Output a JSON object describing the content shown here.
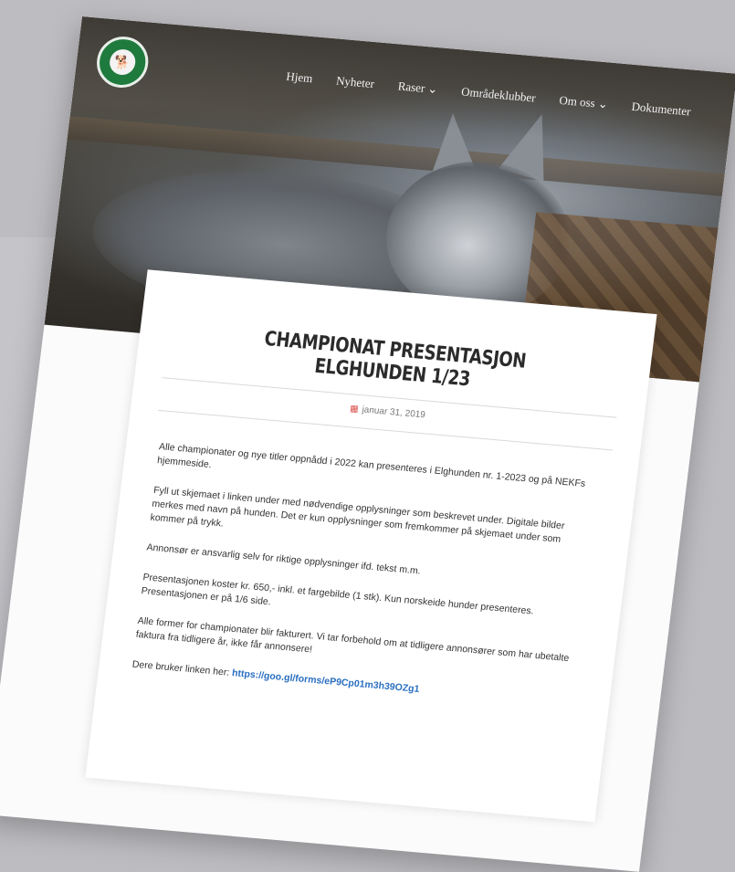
{
  "nav": {
    "items": [
      {
        "label": "Hjem"
      },
      {
        "label": "Nyheter"
      },
      {
        "label": "Raser ⌄"
      },
      {
        "label": "Områdeklubber"
      },
      {
        "label": "Om oss ⌄"
      },
      {
        "label": "Dokumenter"
      }
    ]
  },
  "article": {
    "title": "CHAMPIONAT PRESENTASJON ELGHUNDEN 1/23",
    "date": "januar 31, 2019",
    "paragraphs": [
      "Alle championater og nye titler oppnådd i 2022 kan presenteres i Elghunden nr. 1-2023 og på NEKFs hjemmeside.",
      "Fyll ut skjemaet i linken under med nødvendige opplysninger som beskrevet under. Digitale bilder merkes med navn på hunden. Det er kun opplysninger som fremkommer på skjemaet under som kommer på trykk.",
      "Annonsør er ansvarlig selv for riktige opplysninger ifd. tekst m.m.",
      "Presentasjonen koster kr. 650,- inkl. et fargebilde (1 stk). Kun norskeide hunder presenteres. Presentasjonen er på 1/6 side.",
      "Alle former for championater blir fakturert. Vi tar forbehold om at tidligere annonsører som har ubetalte faktura fra tidligere år, ikke får annonsere!"
    ],
    "link_prefix": "Dere bruker linken her: ",
    "link_text": "https://goo.gl/forms/eP9Cp01m3h39OZg1"
  },
  "colors": {
    "accent": "#1f7a3e",
    "link": "#2a6fc0",
    "date_icon": "#d9534f"
  }
}
